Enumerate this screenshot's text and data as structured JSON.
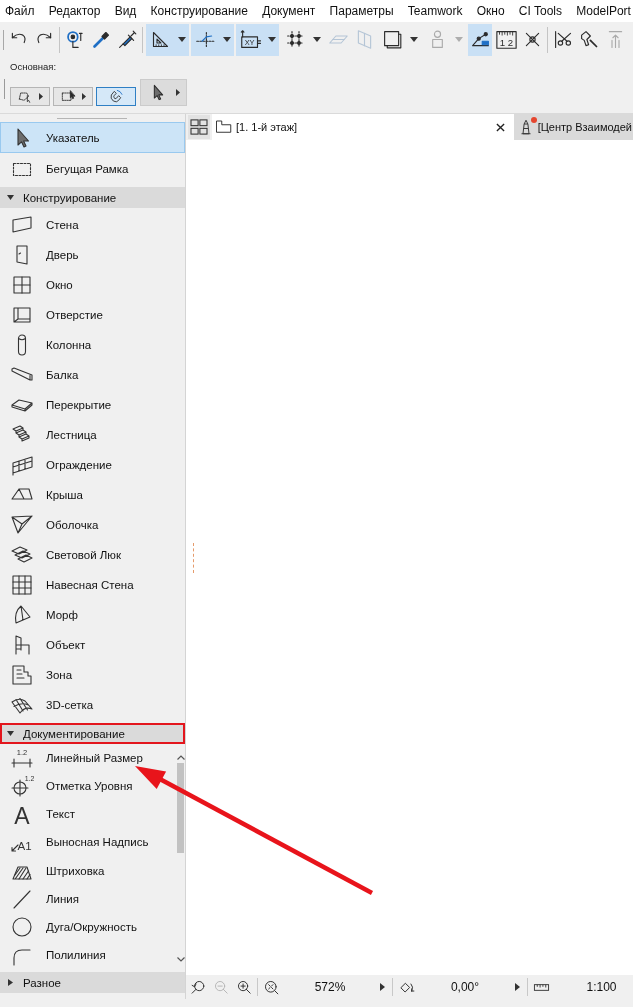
{
  "menu": [
    "Файл",
    "Редактор",
    "Вид",
    "Конструирование",
    "Документ",
    "Параметры",
    "Teamwork",
    "Окно",
    "CI Tools",
    "ModelPort"
  ],
  "toolbar": {
    "groups": [
      {
        "items": [
          {
            "kind": "undo",
            "selected": false,
            "disabled": false,
            "dropdown": false
          },
          {
            "kind": "redo",
            "selected": false,
            "disabled": false,
            "dropdown": false
          }
        ]
      },
      {
        "items": [
          {
            "kind": "select-node",
            "selected": false,
            "disabled": false,
            "dropdown": false
          },
          {
            "kind": "eyedropper",
            "selected": false,
            "disabled": false,
            "dropdown": false
          },
          {
            "kind": "syringe",
            "selected": false,
            "disabled": false,
            "dropdown": false
          }
        ]
      },
      {
        "items": [
          {
            "kind": "angle",
            "selected": true,
            "disabled": false,
            "dropdown": true
          },
          {
            "kind": "guides",
            "selected": true,
            "disabled": false,
            "dropdown": true
          },
          {
            "kind": "coordinates",
            "glyph": "XY",
            "selected": true,
            "disabled": false,
            "dropdown": true
          },
          {
            "kind": "grid-snap",
            "selected": false,
            "disabled": false,
            "dropdown": true
          },
          {
            "kind": "plane-horizontal",
            "selected": false,
            "disabled": true,
            "dropdown": false
          },
          {
            "kind": "plane-vertical",
            "selected": false,
            "disabled": true,
            "dropdown": false
          },
          {
            "kind": "frame",
            "selected": false,
            "disabled": false,
            "dropdown": true
          },
          {
            "kind": "figure",
            "selected": false,
            "disabled": true,
            "dropdown": true
          },
          {
            "kind": "trace",
            "selected": true,
            "disabled": false,
            "dropdown": false
          },
          {
            "kind": "ruler",
            "glyph": "1 2",
            "selected": false,
            "disabled": false,
            "dropdown": false
          },
          {
            "kind": "cross",
            "selected": false,
            "disabled": false,
            "dropdown": false
          }
        ]
      },
      {
        "items": [
          {
            "kind": "scissors",
            "selected": false,
            "disabled": false,
            "dropdown": false
          },
          {
            "kind": "wand",
            "selected": false,
            "disabled": false,
            "dropdown": false
          },
          {
            "kind": "push",
            "selected": false,
            "disabled": true,
            "dropdown": false
          }
        ]
      }
    ]
  },
  "toolset": {
    "title": "Основная:",
    "buttons": [
      {
        "kind": "polygon-select",
        "selected": false,
        "menu": true
      },
      {
        "kind": "marquee-select",
        "selected": false,
        "menu": true
      },
      {
        "kind": "magnet",
        "selected": true,
        "menu": false
      },
      {
        "kind": "pointer",
        "selected": false,
        "menu": true
      }
    ]
  },
  "toolbox": {
    "top_tools": [
      {
        "kind": "pointer",
        "label": "Указатель",
        "selected": true
      },
      {
        "kind": "marquee",
        "label": "Бегущая Рамка",
        "selected": false
      }
    ],
    "sections": [
      {
        "title": "Конструирование",
        "expanded": true,
        "highlighted": false,
        "scrollable": false,
        "tools": [
          {
            "kind": "wall",
            "label": "Стена",
            "selected": false
          },
          {
            "kind": "door",
            "label": "Дверь",
            "selected": false
          },
          {
            "kind": "window",
            "label": "Окно",
            "selected": false
          },
          {
            "kind": "opening",
            "label": "Отверстие",
            "selected": false
          },
          {
            "kind": "column",
            "label": "Колонна",
            "selected": false
          },
          {
            "kind": "beam",
            "label": "Балка",
            "selected": false
          },
          {
            "kind": "slab",
            "label": "Перекрытие",
            "selected": false
          },
          {
            "kind": "stair",
            "label": "Лестница",
            "selected": false
          },
          {
            "kind": "railing",
            "label": "Ограждение",
            "selected": false
          },
          {
            "kind": "roof",
            "label": "Крыша",
            "selected": false
          },
          {
            "kind": "shell",
            "label": "Оболочка",
            "selected": false
          },
          {
            "kind": "skylight",
            "label": "Световой Люк",
            "selected": false
          },
          {
            "kind": "curtain-wall",
            "label": "Навесная Стена",
            "selected": false
          },
          {
            "kind": "morph",
            "label": "Морф",
            "selected": false
          },
          {
            "kind": "object",
            "label": "Объект",
            "selected": false
          },
          {
            "kind": "zone",
            "label": "Зона",
            "selected": false
          },
          {
            "kind": "mesh",
            "label": "3D-сетка",
            "selected": false
          }
        ]
      },
      {
        "title": "Документирование",
        "expanded": true,
        "highlighted": true,
        "scrollable": true,
        "tools": [
          {
            "kind": "dimension",
            "glyph": "1.2",
            "label": "Линейный Размер",
            "selected": false
          },
          {
            "kind": "level",
            "glyph": "1.2",
            "label": "Отметка Уровня",
            "selected": false
          },
          {
            "kind": "text",
            "glyph": "A",
            "label": "Текст",
            "selected": false
          },
          {
            "kind": "label",
            "glyph": "A1",
            "label": "Выносная Надпись",
            "selected": false
          },
          {
            "kind": "fill",
            "label": "Штриховка",
            "selected": false
          },
          {
            "kind": "line",
            "label": "Линия",
            "selected": false
          },
          {
            "kind": "arc",
            "label": "Дуга/Окружность",
            "selected": false
          },
          {
            "kind": "polyline",
            "label": "Полилиния",
            "selected": false
          }
        ]
      },
      {
        "title": "Разное",
        "expanded": false,
        "highlighted": false
      }
    ]
  },
  "view_tabs": [
    {
      "kind": "plan",
      "label": "[1. 1-й этаж]",
      "selected": true,
      "closable": true,
      "notification": false
    },
    {
      "kind": "lighthouse",
      "label": "[Центр Взаимодей",
      "selected": false,
      "closable": false,
      "notification": true
    }
  ],
  "status_bar": {
    "nav": [
      {
        "kind": "zoom-previous",
        "disabled": false
      },
      {
        "kind": "zoom-out",
        "disabled": true
      },
      {
        "kind": "zoom-in",
        "disabled": false
      }
    ],
    "zoom": "572%",
    "angle": "0,00°",
    "scale": "1:100"
  },
  "annotation_arrow": true
}
